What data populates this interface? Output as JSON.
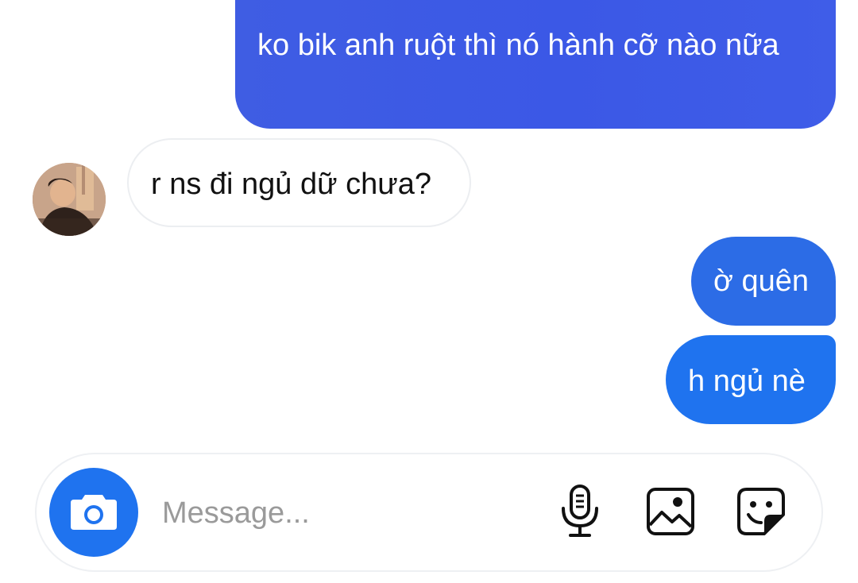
{
  "messages": [
    {
      "direction": "sent",
      "text": "ko bik anh ruột thì nó hành cỡ nào nữa"
    },
    {
      "direction": "received",
      "text": "r ns đi ngủ dữ chưa?"
    },
    {
      "direction": "sent",
      "text": "ờ quên"
    },
    {
      "direction": "sent",
      "text": "h ngủ nè"
    }
  ],
  "composer": {
    "placeholder": "Message...",
    "value": ""
  },
  "icons": {
    "camera": "camera-icon",
    "mic": "microphone-icon",
    "gallery": "image-icon",
    "sticker": "sticker-icon"
  },
  "colors": {
    "sent_gradient": "#3b58e6",
    "sent_bubble": "#1f73ef",
    "received_border": "#eceef1",
    "camera_button": "#1f73ef",
    "placeholder": "#9a9a9a"
  }
}
